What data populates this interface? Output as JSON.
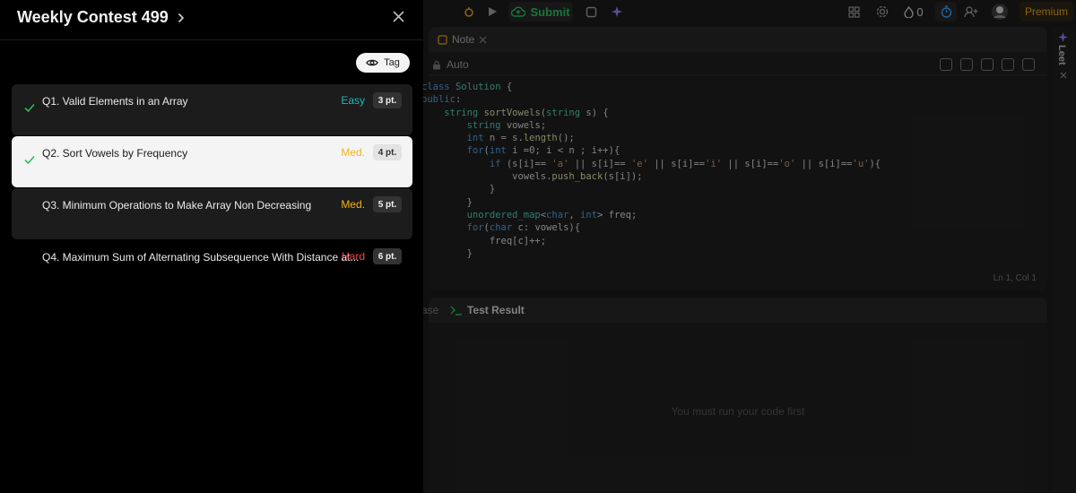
{
  "contest": {
    "title": "Weekly Contest 499",
    "tag_label": "Tag"
  },
  "questions": [
    {
      "label": "Q1. Valid Elements in an Array",
      "difficulty": "Easy",
      "points": "3 pt.",
      "solved": true,
      "diff_color": "#1cbaba"
    },
    {
      "label": "Q2. Sort Vowels by Frequency",
      "difficulty": "Med.",
      "points": "4 pt.",
      "solved": true,
      "diff_color": "#f5b31a"
    },
    {
      "label": "Q3. Minimum Operations to Make Array Non Decreasing",
      "difficulty": "Med.",
      "points": "5 pt.",
      "solved": false,
      "diff_color": "#f5b31a"
    },
    {
      "label": "Q4. Maximum Sum of Alternating Subsequence With Distance at...",
      "difficulty": "Hard",
      "points": "6 pt.",
      "solved": false,
      "diff_color": "#f0494a"
    }
  ],
  "topbar": {
    "submit_label": "Submit",
    "streak_count": "0",
    "premium_label": "Premium"
  },
  "editor": {
    "tab_label": "Note",
    "language_label": "Auto",
    "cursor_position": "Ln 1, Col 1"
  },
  "console": {
    "case_tab": "ase",
    "result_tab": "Test Result",
    "empty_message": "You must run your code first"
  },
  "rail": {
    "label": "Leet"
  },
  "colors": {
    "accent_green": "#2cbb5d",
    "premium": "#e6a11a",
    "check": "#2cbb5d"
  }
}
